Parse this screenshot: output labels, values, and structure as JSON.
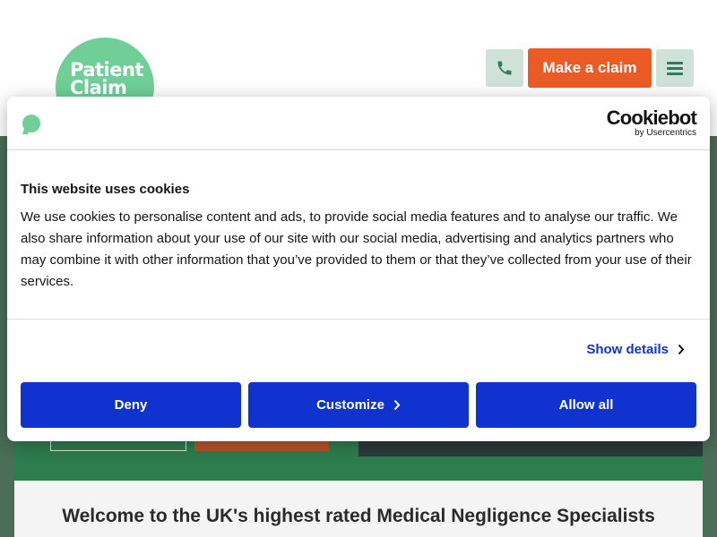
{
  "header": {
    "logo_text_line1": "Patient",
    "logo_text_line2": "Claim",
    "make_claim_label": "Make a claim",
    "icons": {
      "phone": "phone-icon",
      "menu": "hamburger-menu-icon"
    },
    "colors": {
      "accent_orange": "#eb5b25",
      "brand_green": "#6fcf97",
      "icon_bg": "#cfe1d8"
    }
  },
  "cookie_dialog": {
    "brand_name": "Cookiebot",
    "brand_sub": "by Usercentrics",
    "title": "This website uses cookies",
    "body": "We use cookies to personalise content and ads, to provide social media features and to analyse our traffic. We also share information about your use of our site with our social media, advertising and analytics partners who may combine it with other information that you’ve provided to them or that they’ve collected from your use of their services.",
    "show_details_label": "Show details",
    "buttons": {
      "deny": "Deny",
      "customize": "Customize",
      "allow_all": "Allow all"
    },
    "colors": {
      "button_blue": "#1032cf"
    }
  },
  "main": {
    "welcome_title": "Welcome to the UK's highest rated Medical Negligence Specialists"
  }
}
